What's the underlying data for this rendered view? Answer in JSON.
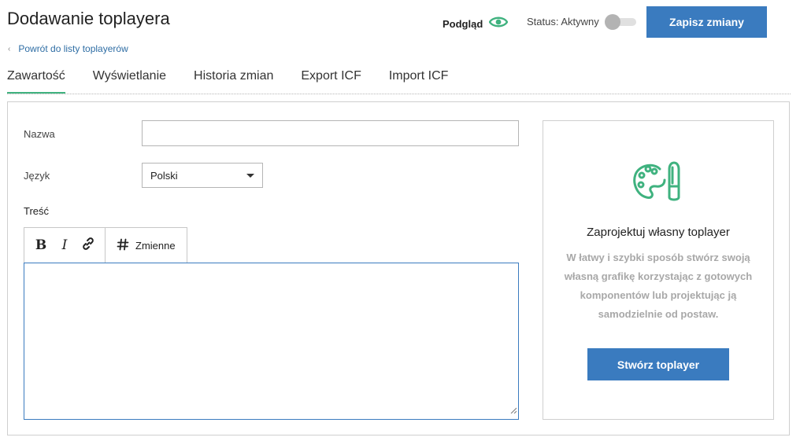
{
  "header": {
    "title": "Dodawanie toplayera",
    "preview_label": "Podgląd",
    "status_label": "Status: Aktywny",
    "save_label": "Zapisz zmiany"
  },
  "back_link": "Powrót do listy toplayerów",
  "tabs": [
    {
      "label": "Zawartość",
      "active": true
    },
    {
      "label": "Wyświetlanie",
      "active": false
    },
    {
      "label": "Historia zmian",
      "active": false
    },
    {
      "label": "Export ICF",
      "active": false
    },
    {
      "label": "Import ICF",
      "active": false
    }
  ],
  "form": {
    "name_label": "Nazwa",
    "name_value": "",
    "language_label": "Język",
    "language_value": "Polski",
    "content_label": "Treść",
    "toolbar": {
      "bold_icon": "bold-icon",
      "italic_icon": "italic-icon",
      "link_icon": "link-icon",
      "variables_icon": "hash-icon",
      "variables_label": "Zmienne"
    },
    "content_value": ""
  },
  "card": {
    "icon": "palette-icon",
    "title": "Zaprojektuj własny toplayer",
    "description": "W łatwy i szybki sposób stwórz swoją własną grafikę korzystając z gotowych komponentów lub projektując ją samodzielnie od postaw.",
    "button_label": "Stwórz toplayer"
  },
  "colors": {
    "accent_green": "#3fb27f",
    "primary_blue": "#3a7bbf",
    "link_blue": "#2e6da4",
    "muted_text": "#a8a8a8"
  }
}
